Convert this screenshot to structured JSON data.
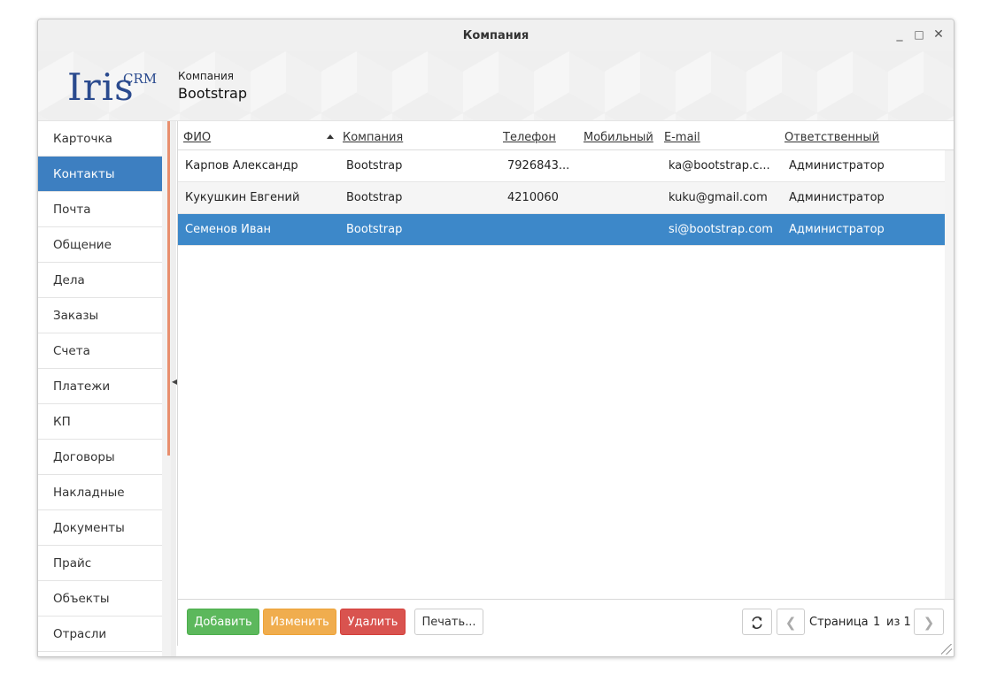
{
  "window": {
    "title": "Компания",
    "controls": {
      "minimize": "_",
      "maximize": "□",
      "close": "✕"
    }
  },
  "header": {
    "logo_main": "Iris",
    "logo_sup": "CRM",
    "company_label": "Компания",
    "company_name": "Bootstrap"
  },
  "sidebar": {
    "items": [
      {
        "label": "Карточка",
        "active": false
      },
      {
        "label": "Контакты",
        "active": true
      },
      {
        "label": "Почта",
        "active": false
      },
      {
        "label": "Общение",
        "active": false
      },
      {
        "label": "Дела",
        "active": false
      },
      {
        "label": "Заказы",
        "active": false
      },
      {
        "label": "Счета",
        "active": false
      },
      {
        "label": "Платежи",
        "active": false
      },
      {
        "label": "КП",
        "active": false
      },
      {
        "label": "Договоры",
        "active": false
      },
      {
        "label": "Накладные",
        "active": false
      },
      {
        "label": "Документы",
        "active": false
      },
      {
        "label": "Прайс",
        "active": false
      },
      {
        "label": "Объекты",
        "active": false
      },
      {
        "label": "Отрасли",
        "active": false
      }
    ]
  },
  "grid": {
    "columns": [
      "ФИО",
      "Компания",
      "Телефон",
      "Мобильный",
      "E-mail",
      "Ответственный"
    ],
    "sorted_column": "ФИО",
    "rows": [
      {
        "fio": "Карпов Александр",
        "company": "Bootstrap",
        "phone": "7926843...",
        "mobile": "",
        "email": "ka@bootstrap.c...",
        "owner": "Администратор",
        "selected": false
      },
      {
        "fio": "Кукушкин Евгений",
        "company": "Bootstrap",
        "phone": "4210060",
        "mobile": "",
        "email": "kuku@gmail.com",
        "owner": "Администратор",
        "selected": false
      },
      {
        "fio": "Семенов Иван",
        "company": "Bootstrap",
        "phone": "",
        "mobile": "",
        "email": "si@bootstrap.com",
        "owner": "Администратор",
        "selected": true
      }
    ]
  },
  "toolbar": {
    "add_label": "Добавить",
    "edit_label": "Изменить",
    "delete_label": "Удалить",
    "print_label": "Печать...",
    "refresh_icon": "refresh-icon"
  },
  "pager": {
    "page_label": "Страница",
    "current_page": "1",
    "of_label": "из 1",
    "prev_icon": "chevron-left-icon",
    "next_icon": "chevron-right-icon"
  },
  "colors": {
    "accent": "#3d7fc1",
    "selected_row": "#3d88c9",
    "add": "#5cb85c",
    "edit": "#f0ad4e",
    "delete": "#d9534f",
    "splitter": "#e88f6e"
  }
}
